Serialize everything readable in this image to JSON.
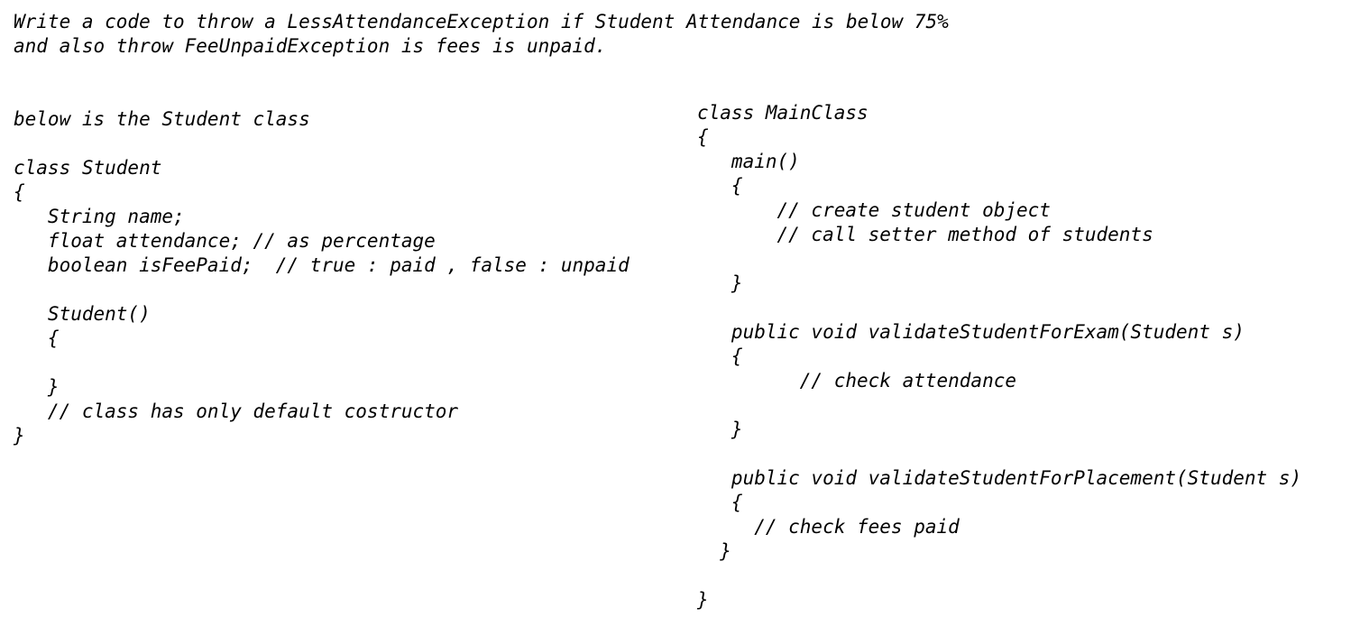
{
  "title": {
    "line1": "Write a code to throw a LessAttendanceException if Student Attendance is below 75%",
    "line2": "and also throw FeeUnpaidException is fees is unpaid."
  },
  "left": {
    "intro": "below is the Student class",
    "lines": [
      "class Student",
      "{",
      "   String name;",
      "   float attendance; // as percentage",
      "   boolean isFeePaid;  // true : paid , false : unpaid",
      "",
      "   Student()",
      "   {",
      "",
      "   }",
      "   // class has only default costructor",
      "}"
    ]
  },
  "right": {
    "lines": [
      "class MainClass",
      "{",
      "   main()",
      "   {",
      "       // create student object",
      "       // call setter method of students",
      "",
      "   }",
      "",
      "   public void validateStudentForExam(Student s)",
      "   {",
      "         // check attendance",
      "",
      "   }",
      "",
      "   public void validateStudentForPlacement(Student s)",
      "   {",
      "     // check fees paid",
      "  }",
      "",
      "}"
    ]
  }
}
